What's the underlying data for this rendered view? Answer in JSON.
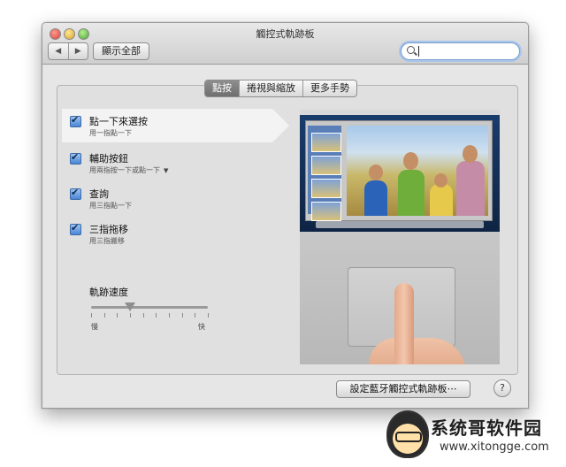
{
  "window": {
    "title": "觸控式軌跡板",
    "back_symbol": "◀",
    "forward_symbol": "▶",
    "show_all_label": "顯示全部",
    "search": {
      "value": "",
      "placeholder": ""
    }
  },
  "tabs": [
    {
      "label": "點按",
      "active": true
    },
    {
      "label": "捲視與縮放",
      "active": false
    },
    {
      "label": "更多手勢",
      "active": false
    }
  ],
  "options": [
    {
      "title": "點一下來選按",
      "subtitle": "用一指點一下",
      "checked": true,
      "selected": true
    },
    {
      "title": "輔助按鈕",
      "subtitle": "用兩指按一下或點一下",
      "checked": true,
      "has_dropdown": true,
      "dropdown_symbol": "▼"
    },
    {
      "title": "查詢",
      "subtitle": "用三指點一下",
      "checked": true
    },
    {
      "title": "三指拖移",
      "subtitle": "用三指搬移",
      "checked": true
    }
  ],
  "tracking_speed": {
    "label": "軌跡速度",
    "min_label": "慢",
    "max_label": "快",
    "value": 0.33,
    "tick_count": 10
  },
  "bluetooth_button_label": "設定藍牙觸控式軌跡板⋯",
  "help_label": "?",
  "watermark": {
    "brand": "系统哥软件园",
    "url": "www.xitongge.com"
  },
  "colors": {
    "active_tab": "#7a7a7a",
    "checkbox_blue": "#4a86d6",
    "search_focus": "#a9c6ec"
  }
}
